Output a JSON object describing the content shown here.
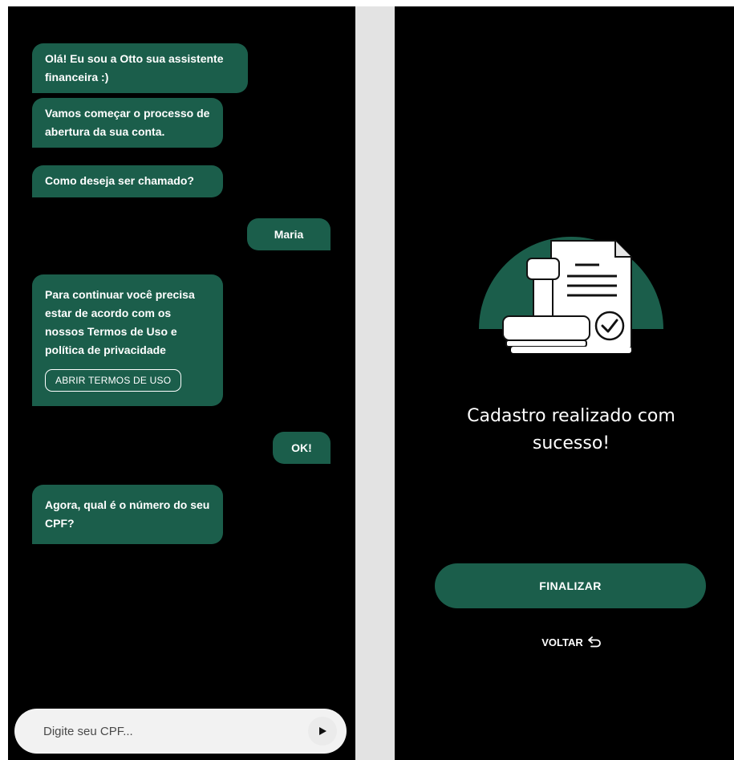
{
  "chat": {
    "messages": [
      {
        "from": "bot",
        "text": "Olá! Eu sou a Otto sua assistente financeira :)"
      },
      {
        "from": "bot",
        "text": "Vamos começar o processo de abertura da sua conta."
      },
      {
        "from": "bot",
        "text": "Como deseja ser chamado?"
      },
      {
        "from": "user",
        "text": "Maria"
      },
      {
        "from": "bot",
        "text": "Para continuar você precisa estar de acordo com os nossos Termos de Uso e política de privacidade",
        "button_label": "ABRIR TERMOS DE USO"
      },
      {
        "from": "user",
        "text": "OK!"
      },
      {
        "from": "bot",
        "text": "Agora, qual é o número do seu CPF?"
      }
    ],
    "input": {
      "placeholder": "Digite seu CPF...",
      "value": "",
      "send_icon": "play-triangle-icon"
    }
  },
  "success": {
    "illustration_icon": "document-stamp-check-icon",
    "title": "Cadastro realizado com sucesso!",
    "finish_label": "FINALIZAR",
    "back_label": "VOLTAR",
    "back_icon": "return-arrow-icon"
  },
  "colors": {
    "accent": "#1b5e4b",
    "background": "#000000",
    "divider": "#e3e3e3",
    "input_bg": "#f2f2f2"
  }
}
